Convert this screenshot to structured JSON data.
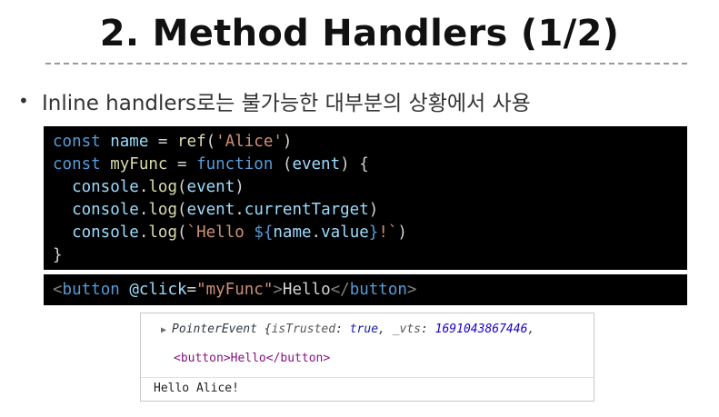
{
  "slide": {
    "title": "2. Method Handlers (1/2)",
    "bullet": "Inline handlers로는 불가능한 대부분의 상황에서 사용"
  },
  "code": {
    "l1": {
      "kw": "const",
      "name": "name",
      "eq": " = ",
      "fn": "ref",
      "open": "(",
      "str": "'Alice'",
      "close": ")"
    },
    "l2": {
      "kw": "const",
      "name": "myFunc",
      "eq": " = ",
      "fnkw": "function",
      "params_open": " (",
      "param": "event",
      "params_close": ") {"
    },
    "l3": {
      "obj": "console",
      "dot": ".",
      "fn": "log",
      "open": "(",
      "arg": "event",
      "close": ")"
    },
    "l4": {
      "obj": "console",
      "dot": ".",
      "fn": "log",
      "open": "(",
      "arg": "event",
      "dot2": ".",
      "prop": "currentTarget",
      "close": ")"
    },
    "l5": {
      "obj": "console",
      "dot": ".",
      "fn": "log",
      "open": "(",
      "str_start": "`Hello ",
      "interp_open": "${",
      "ref": "name",
      "dot2": ".",
      "prop": "value",
      "interp_close": "}",
      "str_end": "!`",
      "close": ")"
    },
    "l6": "}"
  },
  "template": {
    "lt": "<",
    "tag": "button",
    "attr": "@click",
    "eq": "=",
    "value": "\"myFunc\"",
    "gt": ">",
    "text": "Hello",
    "close_lt": "</",
    "close_tag": "button",
    "close_gt": ">"
  },
  "console": {
    "row1": {
      "type": "PointerEvent",
      "open": " {",
      "key1": "isTrusted",
      "colon1": ": ",
      "val1": "true",
      "comma": ", ",
      "key2": "_vts",
      "colon2": ": ",
      "val2": "1691043867446",
      "tail": ","
    },
    "row2": "<button>Hello</button>",
    "row3": "Hello Alice!"
  },
  "colors": {
    "code_bg": "#000000",
    "keyword": "#569cd6",
    "variable": "#9cdcfe",
    "function": "#dcdcaa",
    "string": "#ce9178"
  }
}
